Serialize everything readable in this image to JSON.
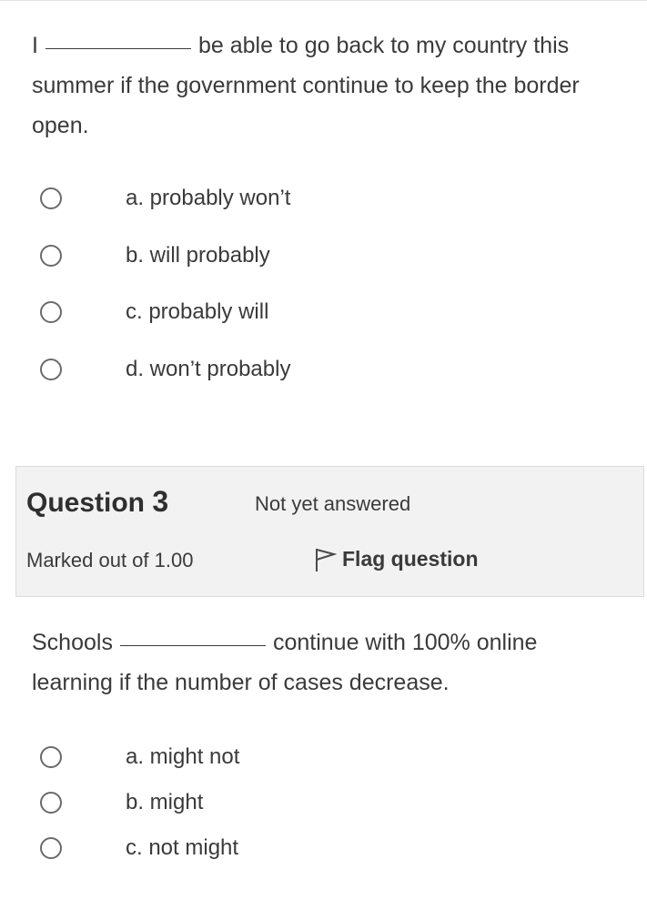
{
  "question2": {
    "text_before": "I",
    "text_after": "be able to go back to my country this summer if the government continue to keep the border open.",
    "options": [
      {
        "label": "a. probably won’t"
      },
      {
        "label": "b. will probably"
      },
      {
        "label": "c. probably will"
      },
      {
        "label": "d. won’t probably"
      }
    ]
  },
  "question3": {
    "heading_prefix": "Question ",
    "number": "3",
    "status": "Not yet answered",
    "marks": "Marked out of 1.00",
    "flag_label": "Flag question",
    "text_before": "Schools",
    "text_after": "continue with 100% online learning if the number of cases decrease.",
    "options": [
      {
        "label": "a. might not"
      },
      {
        "label": "b. might"
      },
      {
        "label": "c. not might"
      }
    ]
  }
}
